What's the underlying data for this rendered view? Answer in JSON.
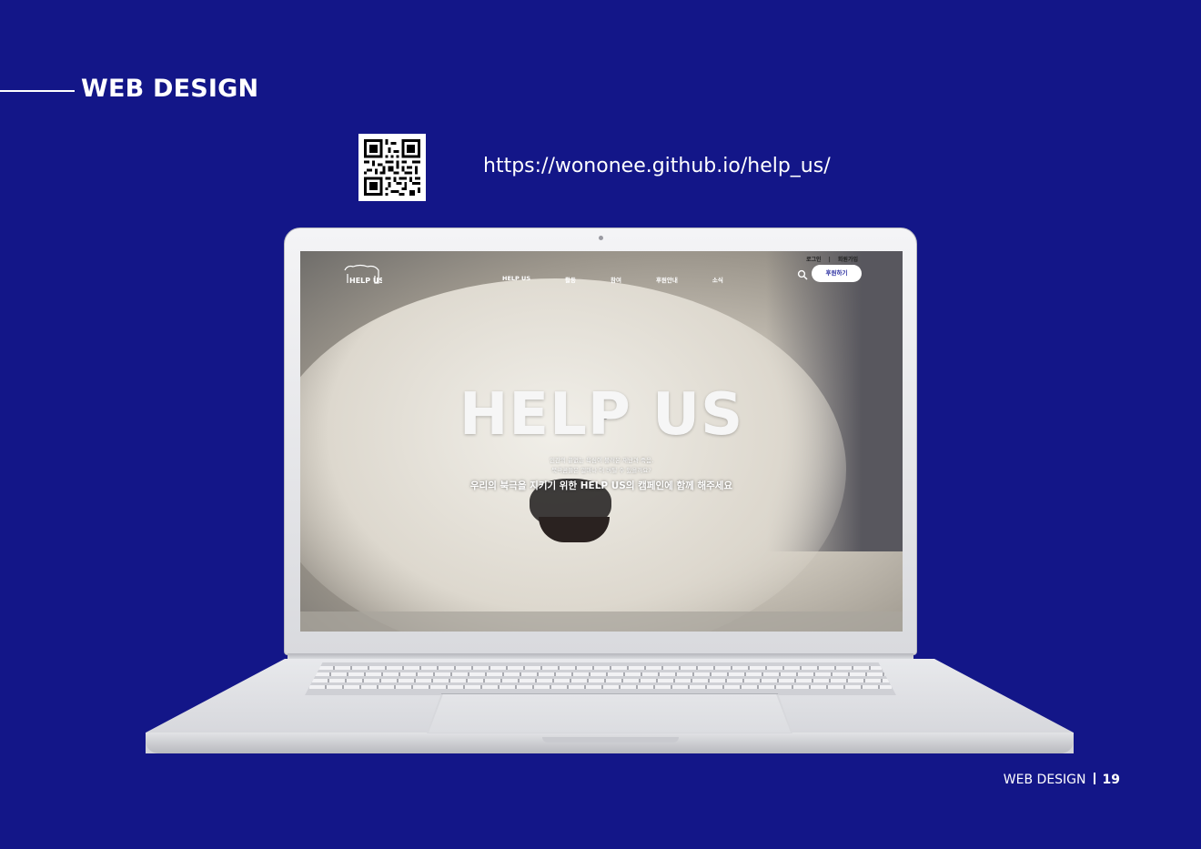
{
  "header": {
    "title": "WEB DESIGN"
  },
  "qr": {
    "icon": "qr-code-icon"
  },
  "url": "https://wononee.github.io/help_us/",
  "site": {
    "top_menu": {
      "login": "로그인",
      "divider": "|",
      "signup": "회원가입"
    },
    "logo_text": "HELP US",
    "nav": [
      "HELP US",
      "활동",
      "참여",
      "후원안내",
      "소식"
    ],
    "donate_button": "후원하기",
    "hero": {
      "title": "HELP US",
      "line1": "인간의 끝없는 욕심이 불러온 재난과 죽음,",
      "line2": "북극곰들은 얼마나 더 버틸 수 있을까요?",
      "cta": "우리의 북극을 지키기 위한 HELP US의 캠페인에 함께 해주세요"
    }
  },
  "footer": {
    "label": "WEB DESIGN",
    "page": "19"
  },
  "colors": {
    "background": "#131688",
    "accent": "#2a2ea0",
    "text": "#ffffff"
  }
}
